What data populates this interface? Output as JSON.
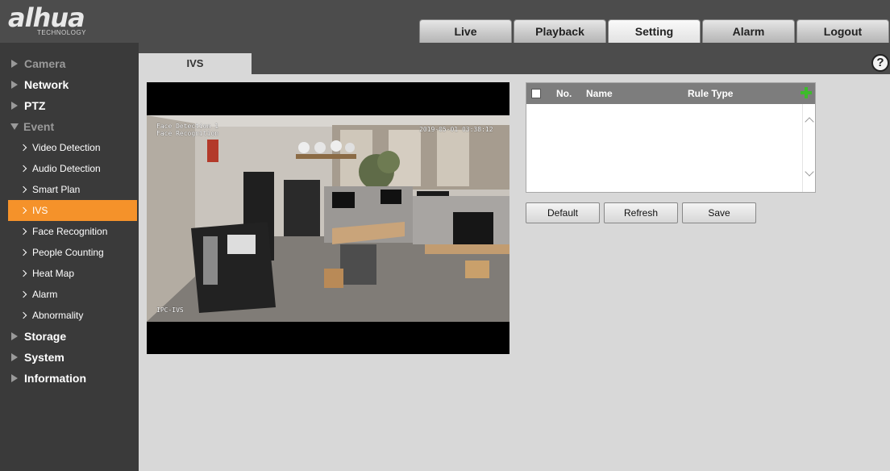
{
  "header": {
    "logo": "alhua",
    "logo_sub": "TECHNOLOGY",
    "tabs": [
      "Live",
      "Playback",
      "Setting",
      "Alarm",
      "Logout"
    ],
    "active_tab": "Setting"
  },
  "sidebar": {
    "top": [
      "Camera",
      "Network",
      "PTZ",
      "Event"
    ],
    "event_items": [
      "Video Detection",
      "Audio Detection",
      "Smart Plan",
      "IVS",
      "Face Recognition",
      "People Counting",
      "Heat Map",
      "Alarm",
      "Abnormality"
    ],
    "bottom": [
      "Storage",
      "System",
      "Information"
    ],
    "active_item": "IVS",
    "accent_color": "#f5922a"
  },
  "content": {
    "tab_label": "IVS",
    "help_label": "?",
    "video": {
      "osd_top_left_1": "Face Detection 1",
      "osd_top_left_2": "Face Recognition",
      "osd_timestamp": "2019-05-01 03:38:12",
      "osd_bottom_left": "IPC-IVS"
    },
    "rules_table": {
      "columns": [
        "No.",
        "Name",
        "Rule Type"
      ],
      "rows": []
    },
    "buttons": {
      "default": "Default",
      "refresh": "Refresh",
      "save": "Save"
    }
  }
}
